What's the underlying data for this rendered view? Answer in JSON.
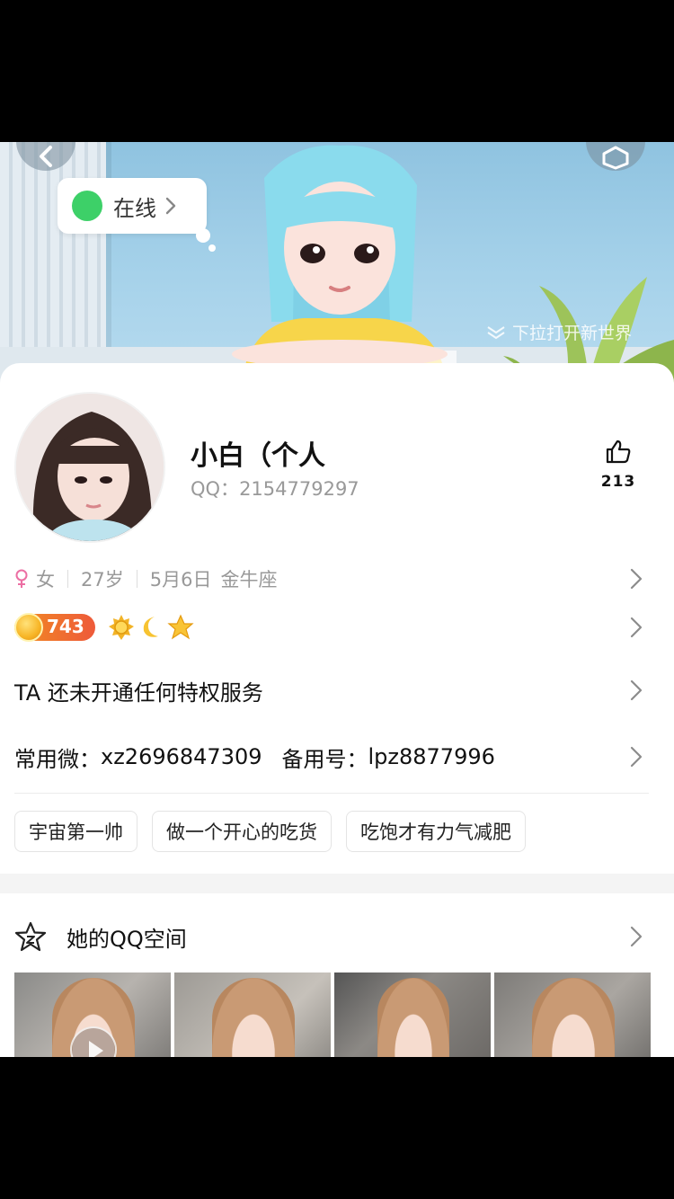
{
  "banner": {
    "status": "在线",
    "pull_hint": "下拉打开新世界"
  },
  "profile": {
    "nickname": "小白（个人",
    "qq_label": "QQ：",
    "qq_number": "2154779297",
    "like_count": "213"
  },
  "info": {
    "gender": "女",
    "age": "27岁",
    "birthday": "5月6日",
    "zodiac": "金牛座"
  },
  "level": {
    "value": "743"
  },
  "privilege": {
    "text": "TA 还未开通任何特权服务"
  },
  "contact": {
    "primary_label": "常用微：",
    "primary_value": "xz2696847309",
    "backup_label": "备用号：",
    "backup_value": "lpz8877996"
  },
  "tags": [
    "宇宙第一帅",
    "做一个开心的吃货",
    "吃饱才有力气减肥"
  ],
  "qzone": {
    "title": "她的QQ空间"
  },
  "colors": {
    "online_green": "#3dd068",
    "level_orange": "#ee5a3a",
    "gender_pink": "#ec6fa3"
  },
  "icons": [
    "back-arrow-icon",
    "share-icon",
    "chevron-right-icon",
    "thumbs-up-icon",
    "female-icon",
    "sun-icon",
    "moon-icon",
    "star-icon",
    "qzone-star-icon",
    "play-icon"
  ]
}
